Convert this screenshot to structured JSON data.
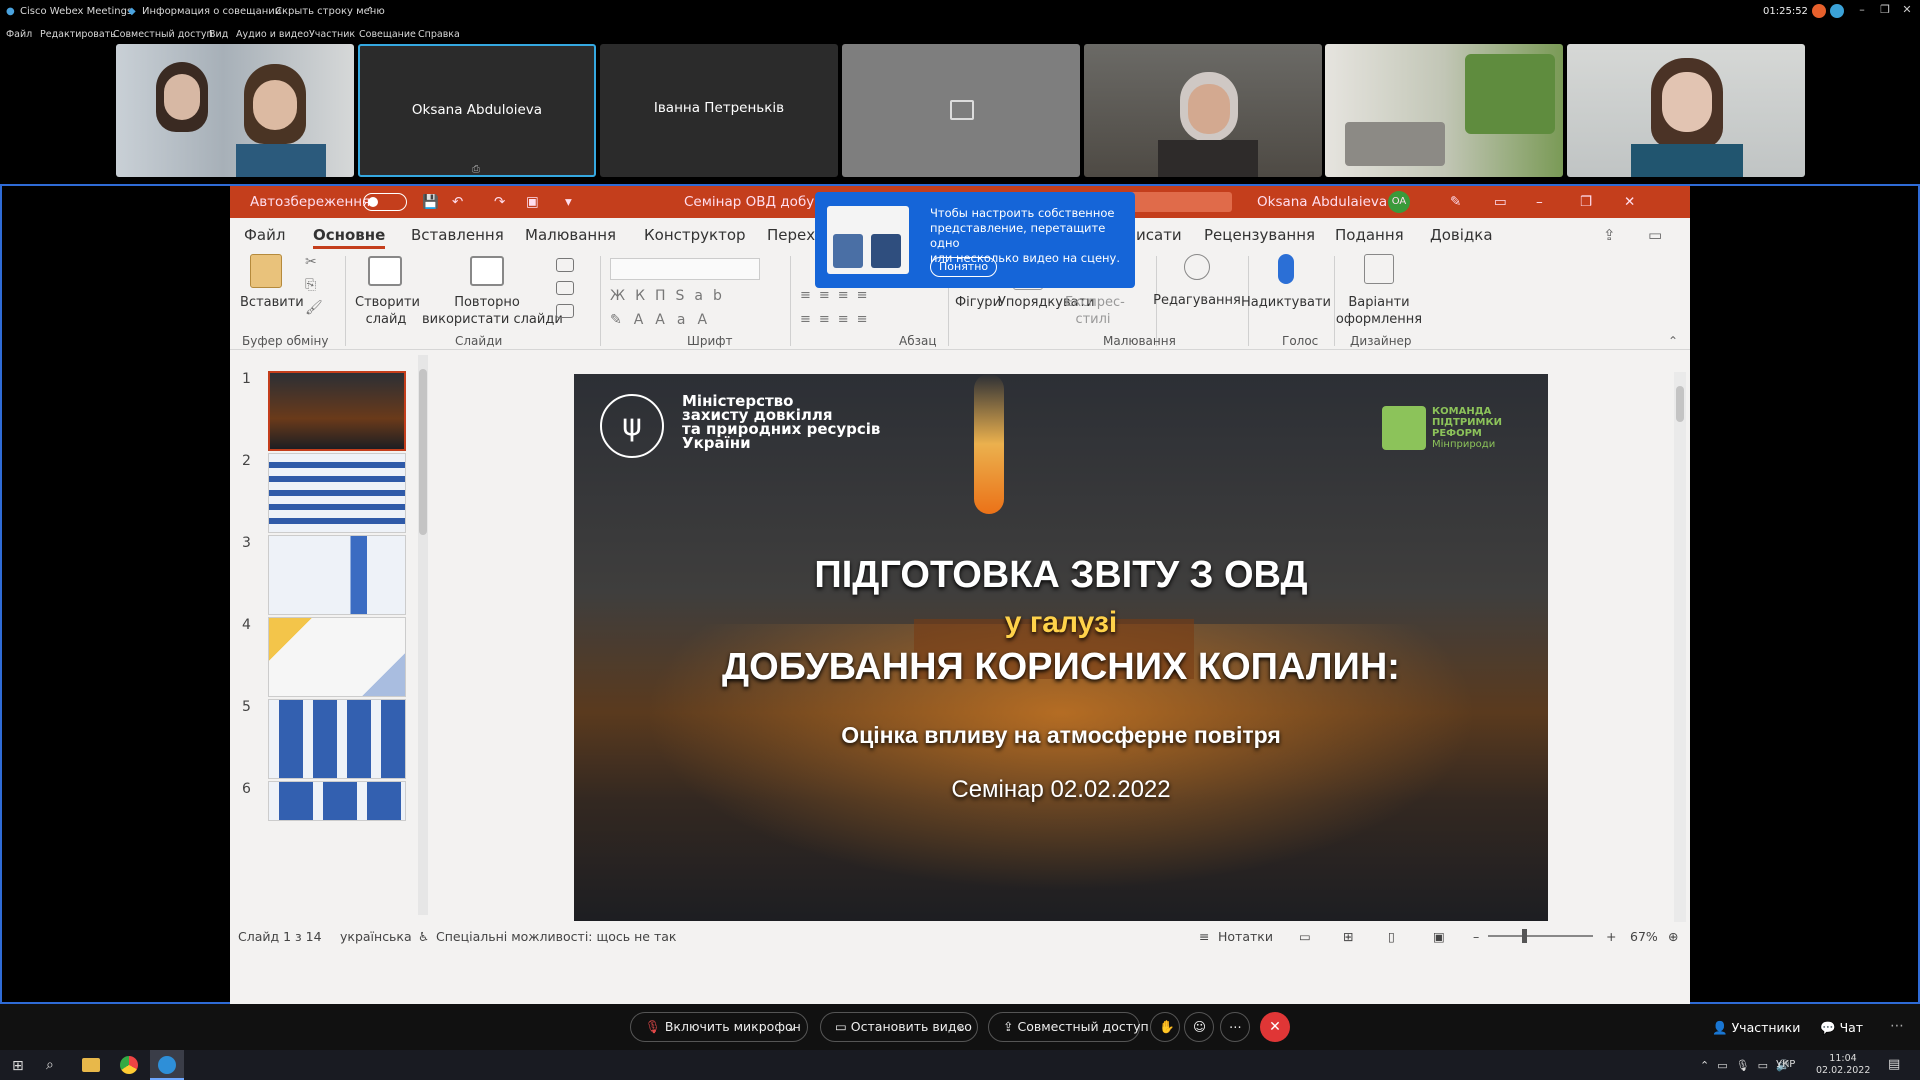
{
  "webex": {
    "app_title": "Cisco Webex Meetings",
    "meeting_info": "Информация о совещании",
    "hide_menu": "Скрыть строку меню",
    "time": "01:25:52",
    "menu": [
      "Файл",
      "Редактировать",
      "Совместный доступ",
      "Вид",
      "Аудио и видео",
      "Участник",
      "Совещание",
      "Справка"
    ]
  },
  "participants": [
    {
      "name": ""
    },
    {
      "name": "Oksana Abduloieva"
    },
    {
      "name": "Іванна Петреньків"
    },
    {
      "name": ""
    },
    {
      "name": ""
    },
    {
      "name": ""
    },
    {
      "name": ""
    }
  ],
  "ppt": {
    "autosave": "Автозбереження",
    "doc_title": "Семінар ОВД добу...",
    "user": "Oksana Abdulaieva",
    "user_initials": "OA",
    "tabs": [
      "Файл",
      "Основне",
      "Вставлення",
      "Малювання",
      "Конструктор",
      "Перех",
      "Рецензування",
      "Подання",
      "Довідка"
    ],
    "tab_partial": "исати",
    "ribbon": {
      "paste": "Вставити",
      "new_slide": [
        "Створити",
        "слайд"
      ],
      "reuse": [
        "Повторно",
        "використати слайди"
      ],
      "shapes": "Фігури",
      "arrange": "Упорядкувати",
      "styles": [
        "Експрес-",
        "стилі"
      ],
      "editing": "Редагування",
      "dictate": "Надиктувати",
      "designer": [
        "Варіанти",
        "оформлення"
      ],
      "groups": [
        "Буфер обміну",
        "Слайди",
        "Шрифт",
        "Абзац",
        "Малювання",
        "Голос",
        "Дизайнер"
      ]
    },
    "slide_numbers": [
      "1",
      "2",
      "3",
      "4",
      "5",
      "6"
    ],
    "slide": {
      "ministry": [
        "Міністерство",
        "захисту довкілля",
        "та природних ресурсів",
        "України"
      ],
      "badge": [
        "КОМАНДА",
        "ПІДТРИМКИ",
        "РЕФОРМ",
        "Мінприроди"
      ],
      "title1": "ПІДГОТОВКА ЗВІТУ З ОВД",
      "title2": "у галузі",
      "title3": "ДОБУВАННЯ КОРИСНИХ КОПАЛИН:",
      "subtitle": "Оцінка впливу на атмосферне повітря",
      "date": "Семінар 02.02.2022"
    },
    "status": {
      "slide": "Слайд 1 з 14",
      "lang": "українська",
      "access": "Спеціальні можливості: щось не так",
      "notes": "Нотатки",
      "zoom": "67%"
    }
  },
  "tooltip": {
    "text": [
      "Чтобы настроить собственное",
      "представление, перетащите одно",
      "или несколько видео на сцену."
    ],
    "button": "Понятно"
  },
  "controls": {
    "mic": "Включить микрофон",
    "video": "Остановить видео",
    "share": "Совместный доступ",
    "participants": "Участники",
    "chat": "Чат"
  },
  "taskbar": {
    "lang": "УКР",
    "time": "11:04",
    "date": "02.02.2022"
  }
}
